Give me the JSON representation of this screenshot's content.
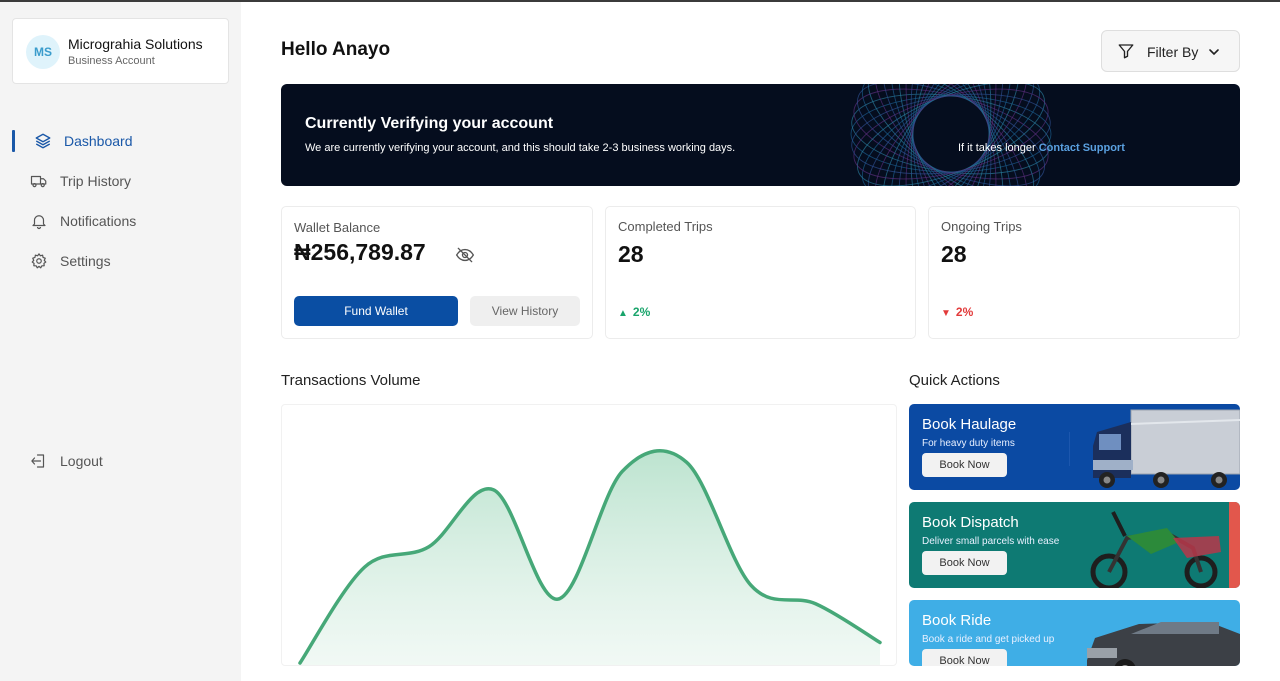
{
  "account": {
    "initials": "MS",
    "name": "Micrograhia Solutions",
    "type": "Business Account"
  },
  "sidebar": {
    "items": [
      {
        "label": "Dashboard",
        "icon": "layers-icon",
        "active": true
      },
      {
        "label": "Trip History",
        "icon": "truck-icon"
      },
      {
        "label": "Notifications",
        "icon": "bell-icon"
      },
      {
        "label": "Settings",
        "icon": "gear-icon"
      }
    ],
    "logout": "Logout"
  },
  "header": {
    "greeting": "Hello Anayo",
    "filter_label": "Filter By"
  },
  "banner": {
    "title": "Currently Verifying your account",
    "text": "We are currently verifying your account, and this should take 2-3 business working days.",
    "right_prefix": "If it takes longer",
    "link": "Contact Support"
  },
  "wallet": {
    "label": "Wallet Balance",
    "value": "₦256,789.87",
    "fund": "Fund Wallet",
    "history": "View History"
  },
  "completed": {
    "label": "Completed Trips",
    "value": "28",
    "trend": "2%",
    "direction": "up"
  },
  "ongoing": {
    "label": "Ongoing Trips",
    "value": "28",
    "trend": "2%",
    "direction": "down"
  },
  "transactions": {
    "title": "Transactions Volume"
  },
  "chart_data": {
    "type": "area",
    "title": "Transactions Volume",
    "values": [
      0,
      42,
      51,
      76,
      28,
      84,
      88,
      34,
      26,
      9
    ],
    "ylim": [
      0,
      100
    ],
    "color": "#46a878",
    "fill": "#cdebdc",
    "grid": false
  },
  "quick_actions": {
    "title": "Quick Actions",
    "items": [
      {
        "title": "Book Haulage",
        "subtitle": "For heavy duty items",
        "button": "Book Now",
        "bg": "#0b4aa3",
        "art": "truck"
      },
      {
        "title": "Book Dispatch",
        "subtitle": "Deliver small parcels with ease",
        "button": "Book Now",
        "bg": "#0e7a73",
        "art": "motorbike"
      },
      {
        "title": "Book Ride",
        "subtitle": "Book a ride and get picked up",
        "button": "Book Now",
        "bg": "#3faee6",
        "art": "car"
      }
    ]
  },
  "colors": {
    "brand": "#0a4ea3",
    "banner_bg": "#050d1e",
    "up": "#19a46b",
    "down": "#e23a3a",
    "link": "#5aa0e0"
  }
}
